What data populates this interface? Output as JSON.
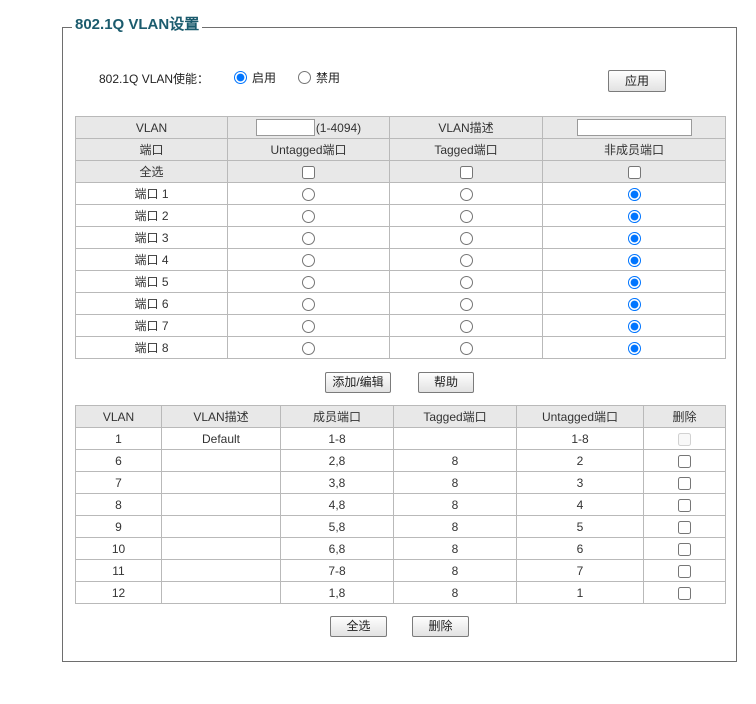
{
  "theme": {
    "title_color": "#1b5b6d",
    "header_bg": "#e8e8e8",
    "border_color": "#b9b9b9"
  },
  "panel": {
    "title": "802.1Q VLAN设置"
  },
  "enable": {
    "label": "802.1Q VLAN使能：",
    "on_label": "启用",
    "on_checked": true,
    "off_label": "禁用",
    "off_checked": false,
    "apply_label": "应用"
  },
  "edit_table": {
    "vlan_label": "VLAN",
    "vlan_value": "",
    "vlan_range": "(1-4094)",
    "desc_label": "VLAN描述",
    "desc_value": "",
    "headers": {
      "port": "端口",
      "untagged": "Untagged端口",
      "tagged": "Tagged端口",
      "nonmember": "非成员端口"
    },
    "select_all": {
      "label": "全选",
      "untagged": false,
      "tagged": false,
      "nonmember": false
    },
    "ports": [
      {
        "name": "端口 1",
        "untagged": false,
        "tagged": false,
        "nonmember": true
      },
      {
        "name": "端口 2",
        "untagged": false,
        "tagged": false,
        "nonmember": true
      },
      {
        "name": "端口 3",
        "untagged": false,
        "tagged": false,
        "nonmember": true
      },
      {
        "name": "端口 4",
        "untagged": false,
        "tagged": false,
        "nonmember": true
      },
      {
        "name": "端口 5",
        "untagged": false,
        "tagged": false,
        "nonmember": true
      },
      {
        "name": "端口 6",
        "untagged": false,
        "tagged": false,
        "nonmember": true
      },
      {
        "name": "端口 7",
        "untagged": false,
        "tagged": false,
        "nonmember": true
      },
      {
        "name": "端口 8",
        "untagged": false,
        "tagged": false,
        "nonmember": true
      }
    ]
  },
  "edit_buttons": {
    "add_label": "添加/编辑",
    "help_label": "帮助"
  },
  "list_table": {
    "headers": {
      "vlan": "VLAN",
      "desc": "VLAN描述",
      "members": "成员端口",
      "tagged": "Tagged端口",
      "untagged": "Untagged端口",
      "delete": "删除"
    },
    "rows": [
      {
        "vlan": "1",
        "desc": "Default",
        "members": "1-8",
        "tagged": "",
        "untagged": "1-8",
        "deletable": false,
        "selected": false
      },
      {
        "vlan": "6",
        "desc": "",
        "members": "2,8",
        "tagged": "8",
        "untagged": "2",
        "deletable": true,
        "selected": false
      },
      {
        "vlan": "7",
        "desc": "",
        "members": "3,8",
        "tagged": "8",
        "untagged": "3",
        "deletable": true,
        "selected": false
      },
      {
        "vlan": "8",
        "desc": "",
        "members": "4,8",
        "tagged": "8",
        "untagged": "4",
        "deletable": true,
        "selected": false
      },
      {
        "vlan": "9",
        "desc": "",
        "members": "5,8",
        "tagged": "8",
        "untagged": "5",
        "deletable": true,
        "selected": false
      },
      {
        "vlan": "10",
        "desc": "",
        "members": "6,8",
        "tagged": "8",
        "untagged": "6",
        "deletable": true,
        "selected": false
      },
      {
        "vlan": "11",
        "desc": "",
        "members": "7-8",
        "tagged": "8",
        "untagged": "7",
        "deletable": true,
        "selected": false
      },
      {
        "vlan": "12",
        "desc": "",
        "members": "1,8",
        "tagged": "8",
        "untagged": "1",
        "deletable": true,
        "selected": false
      }
    ]
  },
  "list_buttons": {
    "select_all_label": "全选",
    "delete_label": "删除"
  }
}
